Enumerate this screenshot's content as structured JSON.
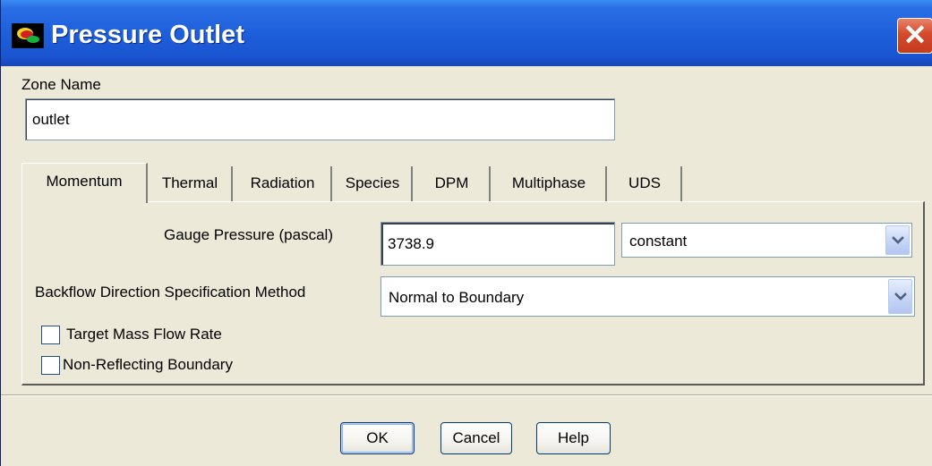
{
  "window": {
    "title": "Pressure Outlet",
    "close_glyph": "✕",
    "icon": "fluent-app-icon"
  },
  "zone": {
    "label": "Zone Name",
    "value": "outlet"
  },
  "tabs": [
    {
      "label": "Momentum",
      "active": true
    },
    {
      "label": "Thermal",
      "active": false
    },
    {
      "label": "Radiation",
      "active": false
    },
    {
      "label": "Species",
      "active": false
    },
    {
      "label": "DPM",
      "active": false
    },
    {
      "label": "Multiphase",
      "active": false
    },
    {
      "label": "UDS",
      "active": false
    }
  ],
  "momentum": {
    "gauge_pressure": {
      "label": "Gauge Pressure (pascal)",
      "value": "3738.9",
      "profile": "constant"
    },
    "backflow": {
      "label": "Backflow Direction Specification Method",
      "value": "Normal to Boundary"
    },
    "target_mass_flow": {
      "label": "Target Mass Flow Rate",
      "checked": false
    },
    "non_reflecting": {
      "label": "Non-Reflecting Boundary",
      "checked": false
    }
  },
  "buttons": {
    "ok": "OK",
    "cancel": "Cancel",
    "help": "Help"
  },
  "colors": {
    "titlebar": "#1e5fdc",
    "dialog_bg": "#ece9d8",
    "close_button": "#d34b2c",
    "dropdown_arrow": "#4d6185"
  }
}
